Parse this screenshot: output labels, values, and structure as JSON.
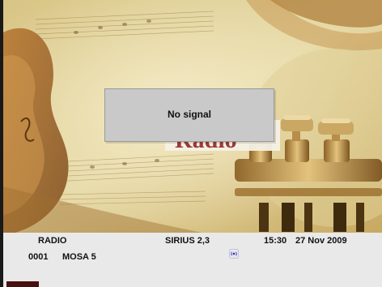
{
  "background": {
    "word": "Radio",
    "colors": {
      "parchment": "#c9b071",
      "brass": "#b98a3a",
      "word": "#9b3a3a"
    }
  },
  "dialog": {
    "message": "No signal"
  },
  "info_bar": {
    "mode_label": "RADIO",
    "satellite": "SIRIUS 2,3",
    "time": "15:30",
    "date": "27 Nov 2009",
    "channel_number": "0001",
    "channel_name": "MOSA 5",
    "icon": "radio-signal-icon"
  }
}
